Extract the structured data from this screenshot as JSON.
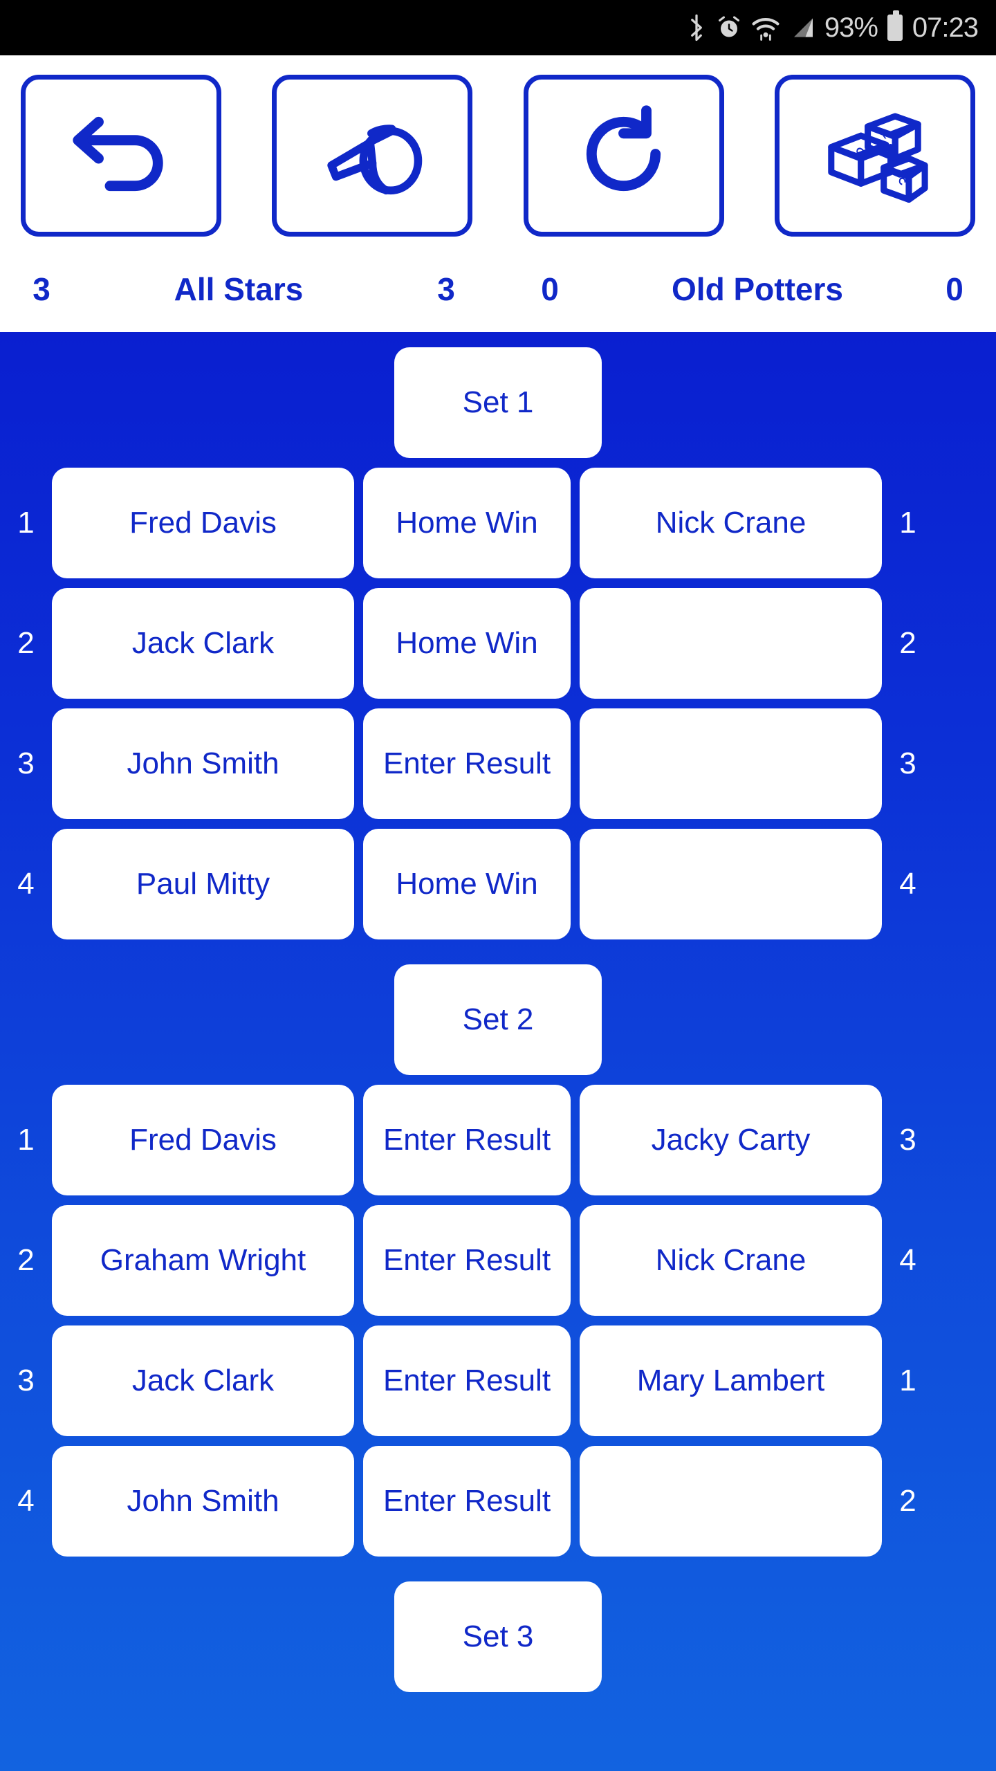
{
  "status_bar": {
    "icons": [
      "bluetooth-icon",
      "alarm-icon",
      "wifi-icon",
      "signal-icon"
    ],
    "battery_percent": "93%",
    "battery_icon": "battery-icon",
    "time": "07:23"
  },
  "toolbar": {
    "buttons": [
      {
        "name": "back-button",
        "icon": "back-arrow-icon"
      },
      {
        "name": "whistle-button",
        "icon": "whistle-icon"
      },
      {
        "name": "refresh-button",
        "icon": "refresh-icon"
      },
      {
        "name": "leaderboard-button",
        "icon": "podium-icon"
      }
    ]
  },
  "scoreboard": {
    "home_sets": "3",
    "home_team": "All Stars",
    "home_points": "3",
    "away_points": "0",
    "away_team": "Old Potters",
    "away_sets": "0"
  },
  "colors": {
    "brand_blue": "#1028C8",
    "background_top": "#0A1FD0",
    "background_bottom": "#1263E0",
    "card_white": "#FFFFFF",
    "status_bar_bg": "#000000"
  },
  "sets": [
    {
      "label": "Set 1",
      "matches": [
        {
          "index": "1",
          "home": "Fred Davis",
          "result": "Home Win",
          "away": "Nick Crane",
          "away_index": "1"
        },
        {
          "index": "2",
          "home": "Jack Clark",
          "result": "Home Win",
          "away": "",
          "away_index": "2"
        },
        {
          "index": "3",
          "home": "John Smith",
          "result": "Enter Result",
          "away": "",
          "away_index": "3"
        },
        {
          "index": "4",
          "home": "Paul Mitty",
          "result": "Home Win",
          "away": "",
          "away_index": "4"
        }
      ]
    },
    {
      "label": "Set 2",
      "matches": [
        {
          "index": "1",
          "home": "Fred Davis",
          "result": "Enter Result",
          "away": "Jacky Carty",
          "away_index": "3"
        },
        {
          "index": "2",
          "home": "Graham Wright",
          "result": "Enter Result",
          "away": "Nick Crane",
          "away_index": "4"
        },
        {
          "index": "3",
          "home": "Jack Clark",
          "result": "Enter Result",
          "away": "Mary Lambert",
          "away_index": "1"
        },
        {
          "index": "4",
          "home": "John Smith",
          "result": "Enter Result",
          "away": "",
          "away_index": "2"
        }
      ]
    },
    {
      "label": "Set 3",
      "matches": []
    }
  ]
}
